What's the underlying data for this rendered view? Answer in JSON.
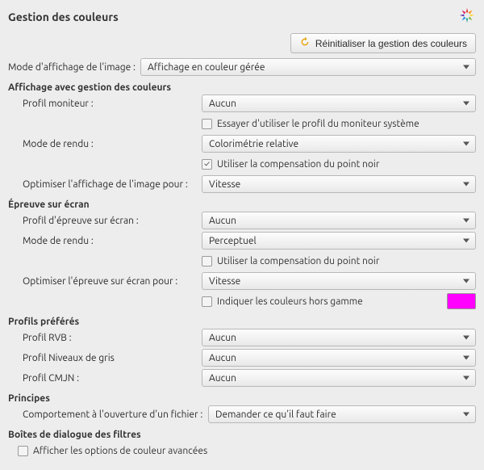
{
  "header": {
    "title": "Gestion des couleurs"
  },
  "reset": {
    "label": "Réinitialiser la gestion des couleurs"
  },
  "mode": {
    "label": "Mode d'affichage de l'image :",
    "value": "Affichage en couleur gérée"
  },
  "section_display": {
    "title": "Affichage avec gestion des couleurs",
    "monitor_label": "Profil moniteur :",
    "monitor_value": "Aucun",
    "try_system_label": "Essayer d'utiliser le profil du moniteur système",
    "render_label": "Mode de rendu :",
    "render_value": "Colorimétrie relative",
    "bpc_label": "Utiliser la compensation du point noir",
    "optimize_label": "Optimiser l'affichage de l'image pour :",
    "optimize_value": "Vitesse"
  },
  "section_proof": {
    "title": "Épreuve sur écran",
    "profile_label": "Profil d'épreuve sur écran :",
    "profile_value": "Aucun",
    "render_label": "Mode de rendu :",
    "render_value": "Perceptuel",
    "bpc_label": "Utiliser la compensation du point noir",
    "optimize_label": "Optimiser l'épreuve sur écran pour :",
    "optimize_value": "Vitesse",
    "gamut_label": "Indiquer les couleurs hors gamme",
    "gamut_color": "#ff00ff"
  },
  "section_preferred": {
    "title": "Profils préférés",
    "rgb_label": "Profil RVB :",
    "rgb_value": "Aucun",
    "gray_label": "Profil Niveaux de gris",
    "gray_value": "Aucun",
    "cmyk_label": "Profil CMJN :",
    "cmyk_value": "Aucun"
  },
  "section_policy": {
    "title": "Principes",
    "open_label": "Comportement à l'ouverture d'un fichier :",
    "open_value": "Demander ce qu'il faut faire"
  },
  "section_filters": {
    "title": "Boîtes de dialogue des filtres",
    "adv_label": "Afficher les options de couleur avancées"
  }
}
